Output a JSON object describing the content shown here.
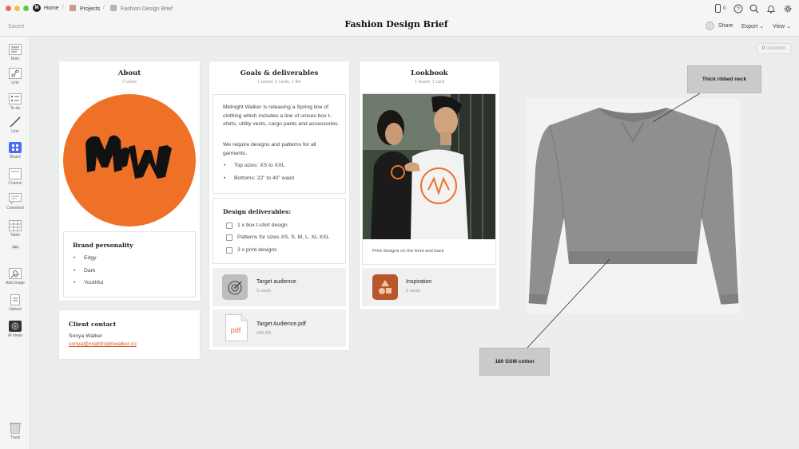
{
  "nav": {
    "home": "Home",
    "projects": "Projects",
    "current": "Fashion Design Brief",
    "separator": "/",
    "colors": {
      "close": "#ec6a5e",
      "minimize": "#f4bf4f",
      "maximize": "#61c554",
      "projects": "#c69a90",
      "current": "#b5b5b5"
    }
  },
  "header": {
    "title": "Fashion Design Brief",
    "saved": "Saved",
    "device_count": "0",
    "share": "Share",
    "export": "Export",
    "view": "View"
  },
  "sidebar": {
    "items": [
      {
        "label": "Note",
        "icon": "note-icon"
      },
      {
        "label": "Link",
        "icon": "link-icon"
      },
      {
        "label": "To-do",
        "icon": "todo-icon"
      },
      {
        "label": "Line",
        "icon": "line-icon"
      },
      {
        "label": "Board",
        "icon": "board-icon"
      },
      {
        "label": "Column",
        "icon": "column-icon"
      },
      {
        "label": "Comment",
        "icon": "comment-icon"
      },
      {
        "label": "Table",
        "icon": "table-icon"
      },
      {
        "label": "",
        "icon": "more-icon"
      },
      {
        "label": "Add image",
        "icon": "add-image-icon"
      },
      {
        "label": "Upload",
        "icon": "upload-icon"
      },
      {
        "label": "AI ideas",
        "icon": "ai-ideas-icon"
      }
    ],
    "trash": "Trash"
  },
  "unsorted": {
    "count": "0",
    "label": "Unsorted"
  },
  "about": {
    "title": "About",
    "subtitle": "2 cards",
    "logo_text": "MW",
    "logo_color": "#ef7128",
    "personality": {
      "heading": "Brand personality",
      "items": [
        "Edgy",
        "Dark",
        "Youthful"
      ]
    }
  },
  "contact": {
    "heading": "Client contact",
    "name": "Sonya Walker",
    "email": "sonya@mightnightwalker.co"
  },
  "goals": {
    "title": "Goals & deliverables",
    "subtitle": "1 board, 2 cards, 1 file",
    "intro": "Midnight Walker is releasing a Spring line of clothing which includes a line of unisex box t-shirts, utility vests, cargo pants and accessories.",
    "require": "We require designs and patterns for all garments.",
    "sizes": [
      "Top sizes: XS to XXL",
      "Bottoms: 22” to 40” waist"
    ],
    "deliverables_heading": "Design deliverables:",
    "deliverables": [
      "1 x box t-shirt design",
      "Patterns for sizes XS, S, M, L, XL XXL",
      "3 x print designs"
    ],
    "board": {
      "title": "Target audience",
      "sub": "0 cards",
      "icon": "target-icon"
    },
    "file": {
      "title": "Target Audience.pdf",
      "sub": "348 KB",
      "type": "pdf"
    }
  },
  "lookbook": {
    "title": "Lookbook",
    "subtitle": "1 board, 1 card",
    "caption": "Print designs on the front and back",
    "board": {
      "title": "Inspiration",
      "sub": "0 cards",
      "icon": "shapes-icon"
    }
  },
  "notes": {
    "neck": "Thick ribbed neck",
    "cotton": "180 GSM cotton"
  }
}
